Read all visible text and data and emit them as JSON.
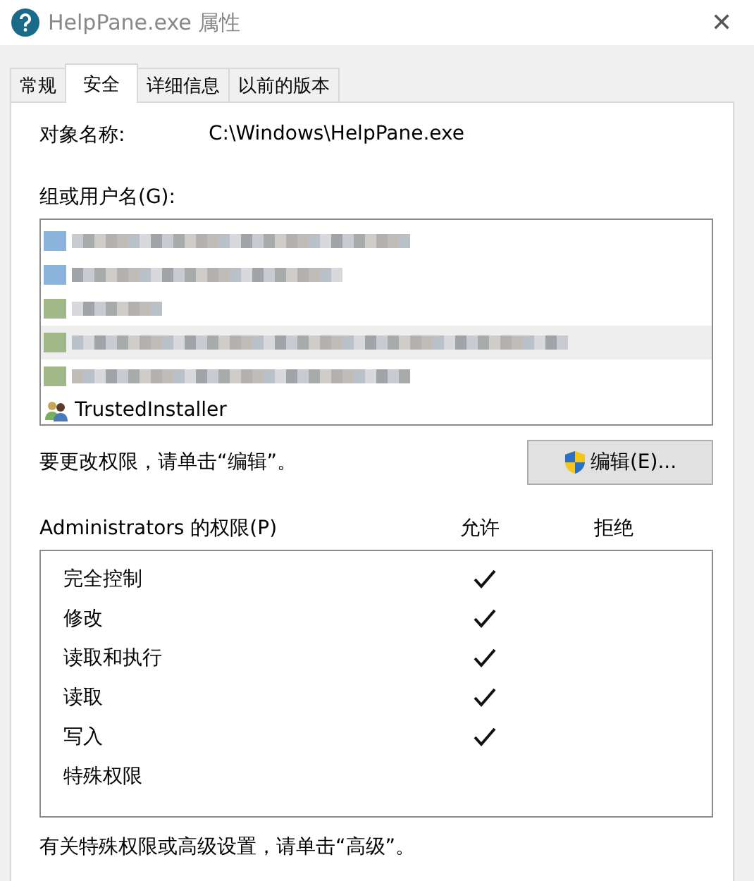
{
  "window": {
    "title": "HelpPane.exe 属性",
    "close": "✕"
  },
  "tabs": [
    {
      "label": "常规",
      "selected": false
    },
    {
      "label": "安全",
      "selected": true
    },
    {
      "label": "详细信息",
      "selected": false
    },
    {
      "label": "以前的版本",
      "selected": false
    }
  ],
  "object_name": {
    "label": "对象名称:",
    "value": "C:\\Windows\\HelpPane.exe"
  },
  "users": {
    "label": "组或用户名(G):",
    "items": [
      {
        "kind": "redacted",
        "selected": false
      },
      {
        "kind": "redacted",
        "selected": false
      },
      {
        "kind": "redacted",
        "selected": false
      },
      {
        "kind": "redacted",
        "selected": true
      },
      {
        "kind": "redacted",
        "selected": false
      },
      {
        "kind": "user",
        "name": "TrustedInstaller",
        "selected": false
      }
    ]
  },
  "edit_hint": "要更改权限，请单击“编辑”。",
  "edit_button": "编辑(E)...",
  "permissions": {
    "title": "Administrators 的权限(P)",
    "allow_header": "允许",
    "deny_header": "拒绝",
    "rows": [
      {
        "name": "完全控制",
        "allow": true,
        "deny": false
      },
      {
        "name": "修改",
        "allow": true,
        "deny": false
      },
      {
        "name": "读取和执行",
        "allow": true,
        "deny": false
      },
      {
        "name": "读取",
        "allow": true,
        "deny": false
      },
      {
        "name": "写入",
        "allow": true,
        "deny": false
      },
      {
        "name": "特殊权限",
        "allow": false,
        "deny": false
      }
    ]
  },
  "advanced_hint": "有关特殊权限或高级设置，请单击“高级”。"
}
